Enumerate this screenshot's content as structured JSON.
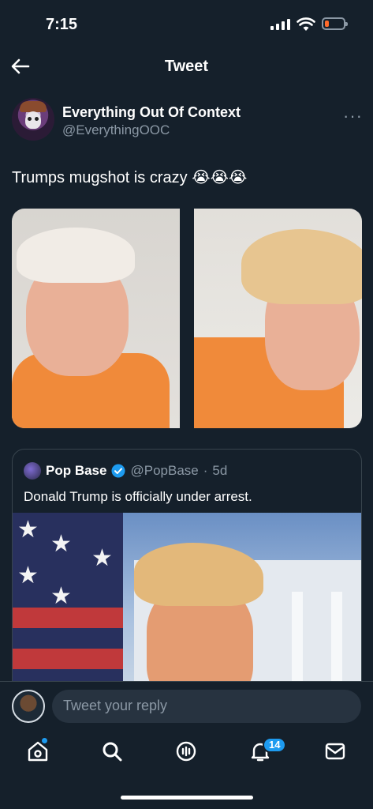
{
  "status_bar": {
    "time": "7:15"
  },
  "header": {
    "title": "Tweet"
  },
  "tweet": {
    "author_name": "Everything Out Of Context",
    "author_handle": "@EverythingOOC",
    "text": "Trumps mugshot is crazy 😭😭😭",
    "more": "···"
  },
  "quoted_tweet": {
    "name": "Pop Base",
    "handle": "@PopBase",
    "separator": "·",
    "time": "5d",
    "text": "Donald Trump is officially under arrest."
  },
  "reply": {
    "placeholder": "Tweet your reply"
  },
  "tab_bar": {
    "items": [
      "home",
      "search",
      "spaces",
      "notifications",
      "messages"
    ],
    "notifications_badge": "14"
  },
  "colors": {
    "background": "#15202b",
    "accent": "#1d9bf0",
    "muted_text": "#8b98a5",
    "border": "#38444d"
  }
}
